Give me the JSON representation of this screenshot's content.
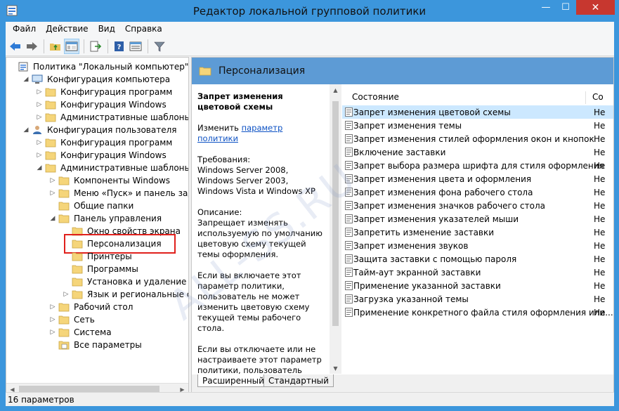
{
  "window": {
    "title": "Редактор локальной групповой политики",
    "buttons": {
      "minimize": "—",
      "maximize": "☐",
      "close": "✕"
    }
  },
  "menu": {
    "items": [
      "Файл",
      "Действие",
      "Вид",
      "Справка"
    ]
  },
  "toolbar": {
    "icons": [
      "back-arrow-icon",
      "forward-arrow-icon",
      "up-folder-icon",
      "show-hide-tree-icon",
      "export-list-icon",
      "help-icon",
      "properties-icon",
      "filter-icon"
    ]
  },
  "tree": {
    "items": [
      {
        "label": "Политика \"Локальный компьютер\"",
        "icon": "policy-icon",
        "level": 0,
        "arrow": "",
        "top": 0
      },
      {
        "label": "Конфигурация компьютера",
        "icon": "computer-icon",
        "level": 1,
        "arrow": "expanded"
      },
      {
        "label": "Конфигурация программ",
        "icon": "folder-icon",
        "level": 2,
        "arrow": "collapsed"
      },
      {
        "label": "Конфигурация Windows",
        "icon": "folder-icon",
        "level": 2,
        "arrow": "collapsed"
      },
      {
        "label": "Административные шаблоны",
        "icon": "folder-icon",
        "level": 2,
        "arrow": "collapsed"
      },
      {
        "label": "Конфигурация пользователя",
        "icon": "user-icon",
        "level": 1,
        "arrow": "expanded"
      },
      {
        "label": "Конфигурация программ",
        "icon": "folder-icon",
        "level": 2,
        "arrow": "collapsed"
      },
      {
        "label": "Конфигурация Windows",
        "icon": "folder-icon",
        "level": 2,
        "arrow": "collapsed"
      },
      {
        "label": "Административные шаблоны",
        "icon": "folder-icon",
        "level": 2,
        "arrow": "expanded"
      },
      {
        "label": "Компоненты Windows",
        "icon": "folder-icon",
        "level": 3,
        "arrow": "collapsed"
      },
      {
        "label": "Меню «Пуск» и панель задач",
        "icon": "folder-icon",
        "level": 3,
        "arrow": "collapsed"
      },
      {
        "label": "Общие папки",
        "icon": "folder-icon",
        "level": 3,
        "arrow": ""
      },
      {
        "label": "Панель управления",
        "icon": "folder-icon",
        "level": 3,
        "arrow": "expanded"
      },
      {
        "label": "Окно свойств экрана",
        "icon": "folder-icon",
        "level": 4,
        "arrow": ""
      },
      {
        "label": "Персонализация",
        "icon": "folder-icon",
        "level": 4,
        "arrow": "",
        "selected": true
      },
      {
        "label": "Принтеры",
        "icon": "folder-icon",
        "level": 4,
        "arrow": ""
      },
      {
        "label": "Программы",
        "icon": "folder-icon",
        "level": 4,
        "arrow": ""
      },
      {
        "label": "Установка и удаление прогр",
        "icon": "folder-icon",
        "level": 4,
        "arrow": ""
      },
      {
        "label": "Язык и региональные станда",
        "icon": "folder-icon",
        "level": 4,
        "arrow": "collapsed"
      },
      {
        "label": "Рабочий стол",
        "icon": "folder-icon",
        "level": 3,
        "arrow": "collapsed"
      },
      {
        "label": "Сеть",
        "icon": "folder-icon",
        "level": 3,
        "arrow": "collapsed"
      },
      {
        "label": "Система",
        "icon": "folder-icon",
        "level": 3,
        "arrow": "collapsed"
      },
      {
        "label": "Все параметры",
        "icon": "all-settings-icon",
        "level": 3,
        "arrow": ""
      }
    ]
  },
  "right": {
    "header_title": "Персонализация",
    "description": {
      "title": "Запрет изменения цветовой схемы",
      "edit_prefix": "Изменить ",
      "edit_link": "параметр политики",
      "requirements": "Требования:\nWindows Server 2008, Windows Server 2003, Windows Vista и Windows XP",
      "description_label": "Описание:",
      "description_text": "Запрещает изменять используемую по умолчанию цветовую схему текущей темы оформления.",
      "para_enabled": "Если вы включаете этот параметр политики, пользователь не может изменить цветовую схему текущей темы рабочего стола.",
      "para_disabled": "Если вы отключаете или не настраиваете этот параметр политики, пользователь может изменить цветовую схему текущей темы рабочего стола."
    },
    "list": {
      "col_name": "Состояние",
      "col_state": "Со",
      "rows": [
        {
          "name": "Запрет изменения цветовой схемы",
          "state": "Не",
          "selected": true
        },
        {
          "name": "Запрет изменения темы",
          "state": "Не"
        },
        {
          "name": "Запрет изменения стилей оформления окон и кнопок",
          "state": "Не"
        },
        {
          "name": "Включение заставки",
          "state": "Не"
        },
        {
          "name": "Запрет выбора размера шрифта для стиля оформления",
          "state": "Не"
        },
        {
          "name": "Запрет изменения цвета и оформления",
          "state": "Не"
        },
        {
          "name": "Запрет изменения фона рабочего стола",
          "state": "Не"
        },
        {
          "name": "Запрет изменения значков рабочего стола",
          "state": "Не"
        },
        {
          "name": "Запрет изменения указателей мыши",
          "state": "Не"
        },
        {
          "name": "Запретить изменение заставки",
          "state": "Не"
        },
        {
          "name": "Запрет изменения звуков",
          "state": "Не"
        },
        {
          "name": "Защита заставки с помощью пароля",
          "state": "Не"
        },
        {
          "name": "Тайм-аут экранной заставки",
          "state": "Не"
        },
        {
          "name": "Применение указанной заставки",
          "state": "Не"
        },
        {
          "name": "Загрузка указанной темы",
          "state": "Не"
        },
        {
          "name": "Применение конкретного файла стиля оформления или...",
          "state": "Не"
        }
      ]
    },
    "tabs": [
      "Расширенный",
      "Стандартный"
    ]
  },
  "status": {
    "text": "16 параметров"
  },
  "watermark": "ALL-SS.RU",
  "colors": {
    "titlebar": "#3c96dc",
    "close": "#c7372f",
    "header": "#5d9bd5",
    "selection_outline": "#e0201c",
    "link": "#0d52c4"
  }
}
